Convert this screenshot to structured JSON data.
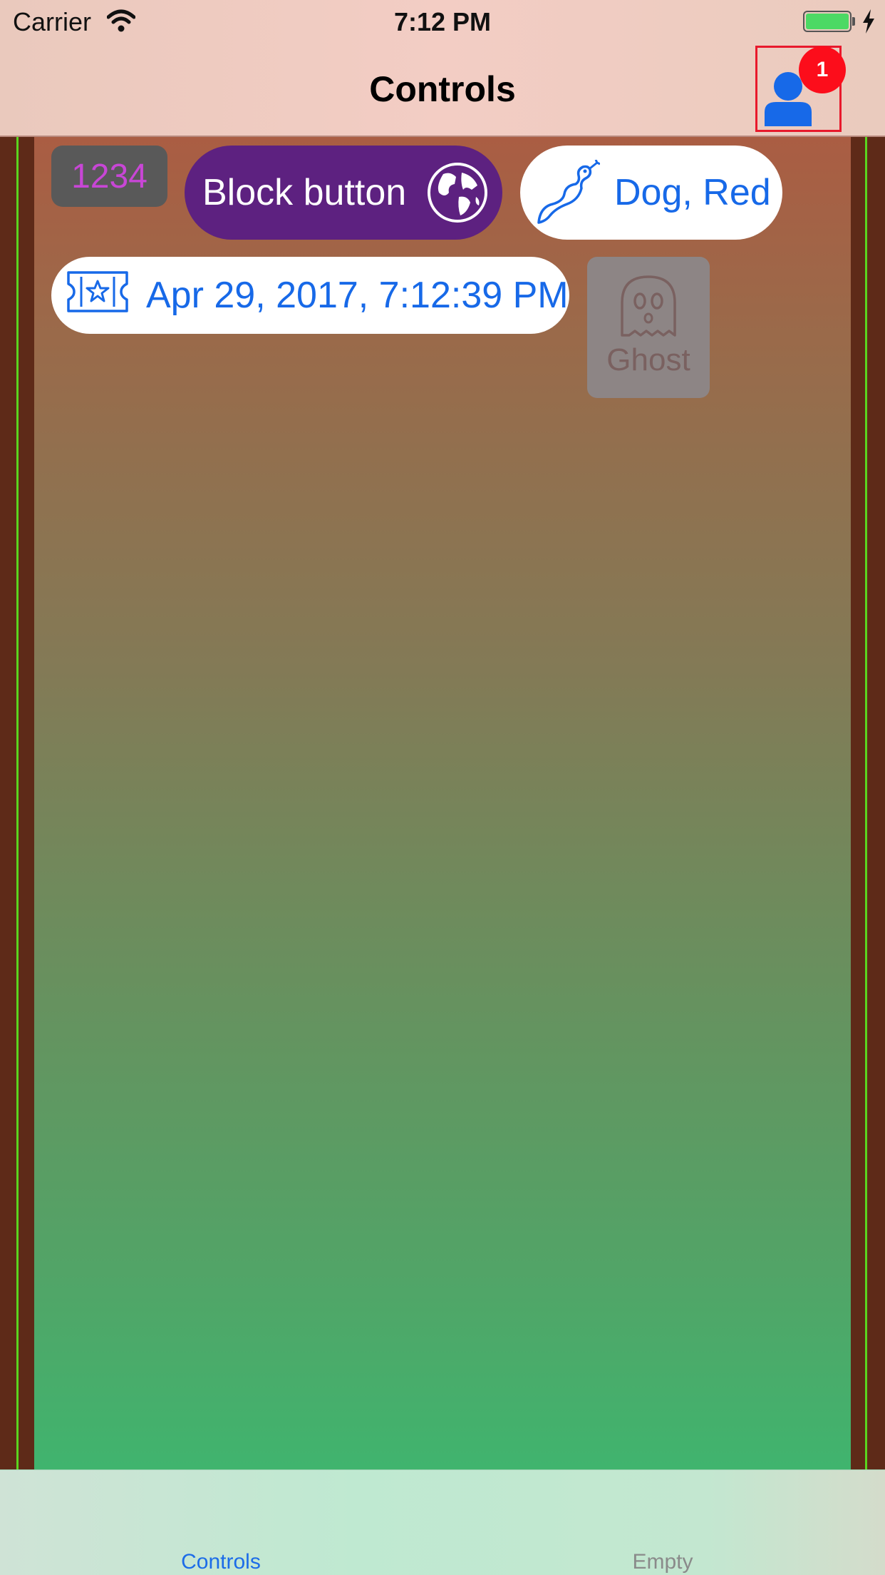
{
  "status_bar": {
    "carrier": "Carrier",
    "time": "7:12 PM",
    "battery_color": "#4cd964"
  },
  "nav_bar": {
    "title": "Controls",
    "profile_icon": "person-icon",
    "badge": "1"
  },
  "controls": {
    "number_field_value": "1234",
    "block_button": {
      "label": "Block button",
      "icon": "globe-icon",
      "color": "#5d2180"
    },
    "dog_button": {
      "label": "Dog, Red",
      "icon": "snake-icon"
    },
    "date_button": {
      "label": "Apr 29, 2017, 7:12:39 PM",
      "icon": "ticket-icon"
    },
    "ghost_button": {
      "label": "Ghost",
      "icon": "ghost-icon"
    }
  },
  "tab_bar": {
    "tabs": [
      {
        "label": "Controls",
        "selected": true
      },
      {
        "label": "Empty",
        "selected": false
      }
    ]
  },
  "colors": {
    "accent_blue": "#1769e8",
    "badge_red": "#fc0d1b",
    "guide_green": "#5ad41f"
  }
}
